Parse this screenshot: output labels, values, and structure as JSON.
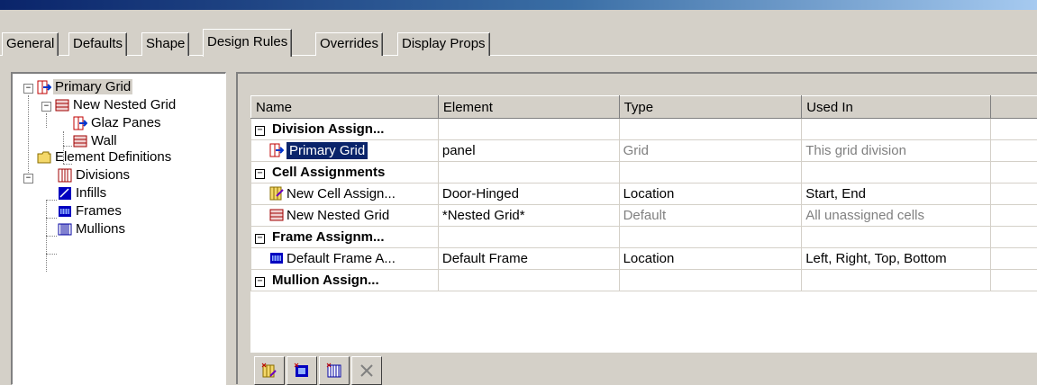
{
  "tabs": [
    "General",
    "Defaults",
    "Shape",
    "Design Rules",
    "Overrides",
    "Display Props"
  ],
  "active_tab": "Design Rules",
  "tree": {
    "primary_grid": "Primary Grid",
    "new_nested_grid": "New Nested Grid",
    "glaz_panes": "Glaz Panes",
    "wall": "Wall",
    "element_definitions": "Element Definitions",
    "divisions": "Divisions",
    "infills": "Infills",
    "frames": "Frames",
    "mullions": "Mullions"
  },
  "grid": {
    "columns": [
      "Name",
      "Element",
      "Type",
      "Used In"
    ],
    "groups": {
      "division": "Division Assign...",
      "cell": "Cell Assignments",
      "frame": "Frame Assignm...",
      "mullion": "Mullion Assign..."
    },
    "rows": {
      "primary": {
        "name": "Primary Grid",
        "element": "panel",
        "type": "Grid",
        "used_in": "This grid division"
      },
      "cell_assign": {
        "name": "New Cell Assign...",
        "element": "Door-Hinged",
        "type": "Location",
        "used_in": "Start, End"
      },
      "nested": {
        "name": "New Nested Grid",
        "element": "*Nested Grid*",
        "type": "Default",
        "used_in": "All unassigned cells"
      },
      "frame": {
        "name": "Default Frame A...",
        "element": "Default Frame",
        "type": "Location",
        "used_in": "Left, Right, Top, Bottom"
      }
    }
  },
  "toolbar_icons": [
    "add-cell-assignment-icon",
    "add-frame-assignment-icon",
    "add-mullion-assignment-icon",
    "delete-icon"
  ],
  "colors": {
    "selection": "#0a246a",
    "face": "#d4d0c8",
    "muted": "#808080"
  }
}
